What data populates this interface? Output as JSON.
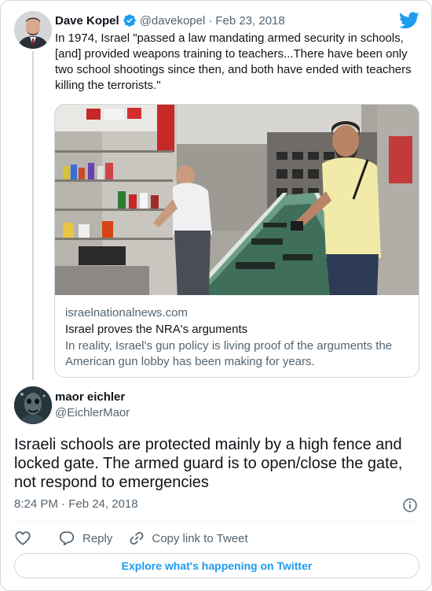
{
  "tweet": {
    "author": {
      "display_name": "Dave Kopel",
      "handle": "@davekopel",
      "verified": true,
      "avatar": "avatar-man-suit"
    },
    "separator": "·",
    "date": "Feb 23, 2018",
    "text": "In 1974, Israel \"passed a law mandating armed security in schools, [and] provided weapons training to teachers...There have been only two school shootings since then, and both have ended with teachers killing the terrorists.\"",
    "link_card": {
      "domain": "israelnationalnews.com",
      "title": "Israel proves the NRA's arguments",
      "description": "In reality, Israel's gun policy is living proof of the arguments the American gun lobby has been making for years.",
      "image": "gun-store-interior-photo"
    }
  },
  "reply": {
    "author": {
      "display_name": "maor eichler",
      "handle": "@EichlerMaor",
      "avatar": "avatar-dark-masked-figure"
    },
    "text": "Israeli schools are protected mainly by a high fence and locked gate. The armed guard is to open/close the gate, not respond to emergencies",
    "timestamp": "8:24 PM · Feb 24, 2018"
  },
  "actions": {
    "like_icon": "heart-icon",
    "reply_label": "Reply",
    "reply_icon": "speech-bubble-icon",
    "copy_label": "Copy link to Tweet",
    "copy_icon": "link-icon"
  },
  "footer": {
    "explore_label": "Explore what's happening on Twitter"
  },
  "icons": {
    "brand": "twitter-bird-icon",
    "info": "info-icon",
    "verified": "verified-badge-icon"
  },
  "colors": {
    "brand_blue": "#1d9bf0",
    "text_primary": "#0f1419",
    "text_secondary": "#536471",
    "border": "#cfd9de"
  }
}
